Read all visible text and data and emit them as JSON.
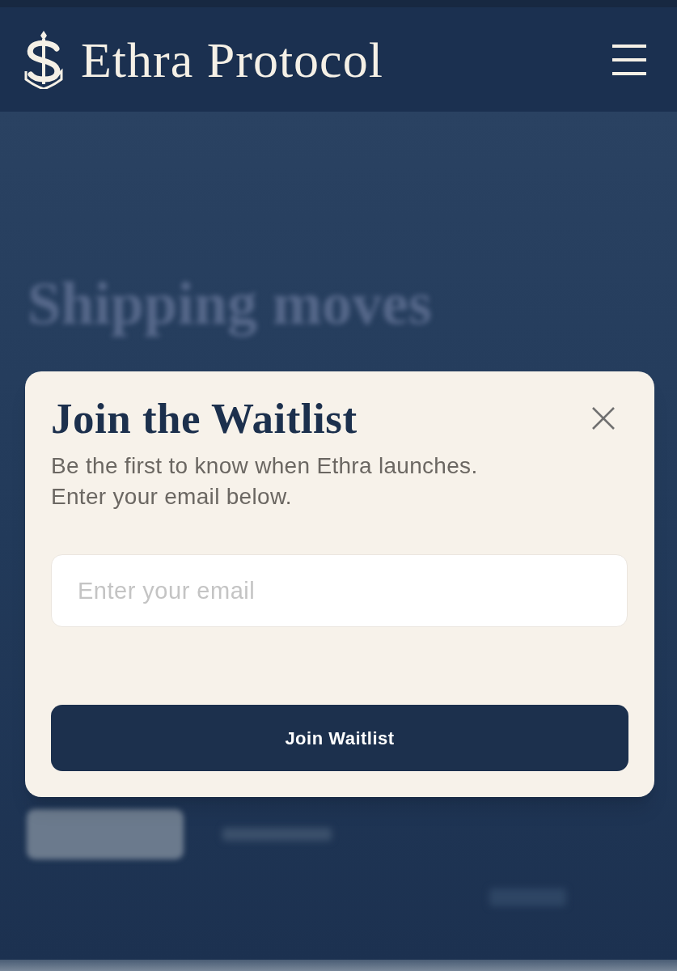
{
  "header": {
    "brand": "Ethra Protocol"
  },
  "background": {
    "heading": "Shipping moves"
  },
  "modal": {
    "title": "Join the Waitlist",
    "description_lines": [
      "Be the first to know when Ethra launches.",
      "Enter your email below."
    ],
    "email_field": {
      "placeholder": "Enter your email"
    },
    "submit_button": "Join Waitlist"
  }
}
